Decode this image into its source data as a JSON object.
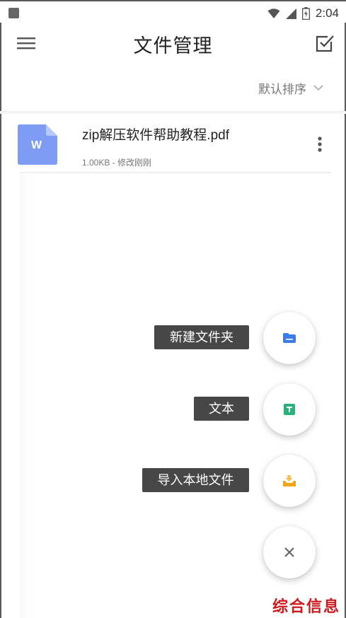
{
  "status_bar": {
    "time": "2:04"
  },
  "app_bar": {
    "title": "文件管理"
  },
  "sort": {
    "label": "默认排序"
  },
  "files": [
    {
      "name": "zip解压软件帮助教程.pdf",
      "meta": "1.00KB - 修改刚刚",
      "icon_letter": "W"
    }
  ],
  "actions": [
    {
      "label": "新建文件夹",
      "icon": "folder-icon"
    },
    {
      "label": "文本",
      "icon": "text-file-icon"
    },
    {
      "label": "导入本地文件",
      "icon": "import-icon"
    }
  ],
  "watermark": "综合信息",
  "colors": {
    "doc_icon": "#7f9cf5",
    "folder_blue": "#3d7be8",
    "text_green": "#27b37a",
    "import_orange": "#f0a51c",
    "label_bg": "#474747"
  }
}
